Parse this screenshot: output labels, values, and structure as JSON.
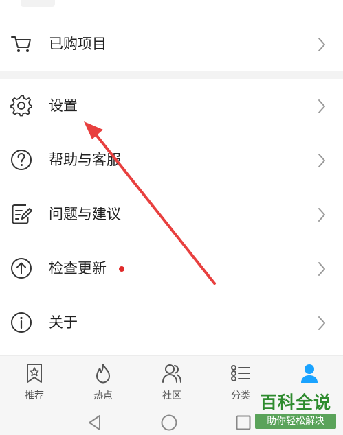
{
  "menu": {
    "purchased": {
      "label": "已购项目",
      "icon": "cart-icon"
    },
    "settings": {
      "label": "设置",
      "icon": "gear-icon"
    },
    "help": {
      "label": "帮助与客服",
      "icon": "question-circle-icon"
    },
    "feedback": {
      "label": "问题与建议",
      "icon": "edit-note-icon"
    },
    "update": {
      "label": "检查更新",
      "icon": "arrow-up-circle-icon",
      "has_badge": true
    },
    "about": {
      "label": "关于",
      "icon": "info-circle-icon"
    }
  },
  "tabbar": {
    "tabs": [
      {
        "label": "推荐",
        "icon": "bookmark-star-icon"
      },
      {
        "label": "热点",
        "icon": "flame-icon"
      },
      {
        "label": "社区",
        "icon": "people-icon"
      },
      {
        "label": "分类",
        "icon": "list-icon"
      },
      {
        "label": "",
        "icon": "person-icon",
        "active": true
      }
    ]
  },
  "watermark": {
    "title": "百科全说",
    "subtitle": "助你轻松解决"
  },
  "colors": {
    "accent": "#1aa3ff",
    "badge": "#e02a2a",
    "arrow": "#e8403f",
    "watermark_green": "#2e8b2e"
  }
}
